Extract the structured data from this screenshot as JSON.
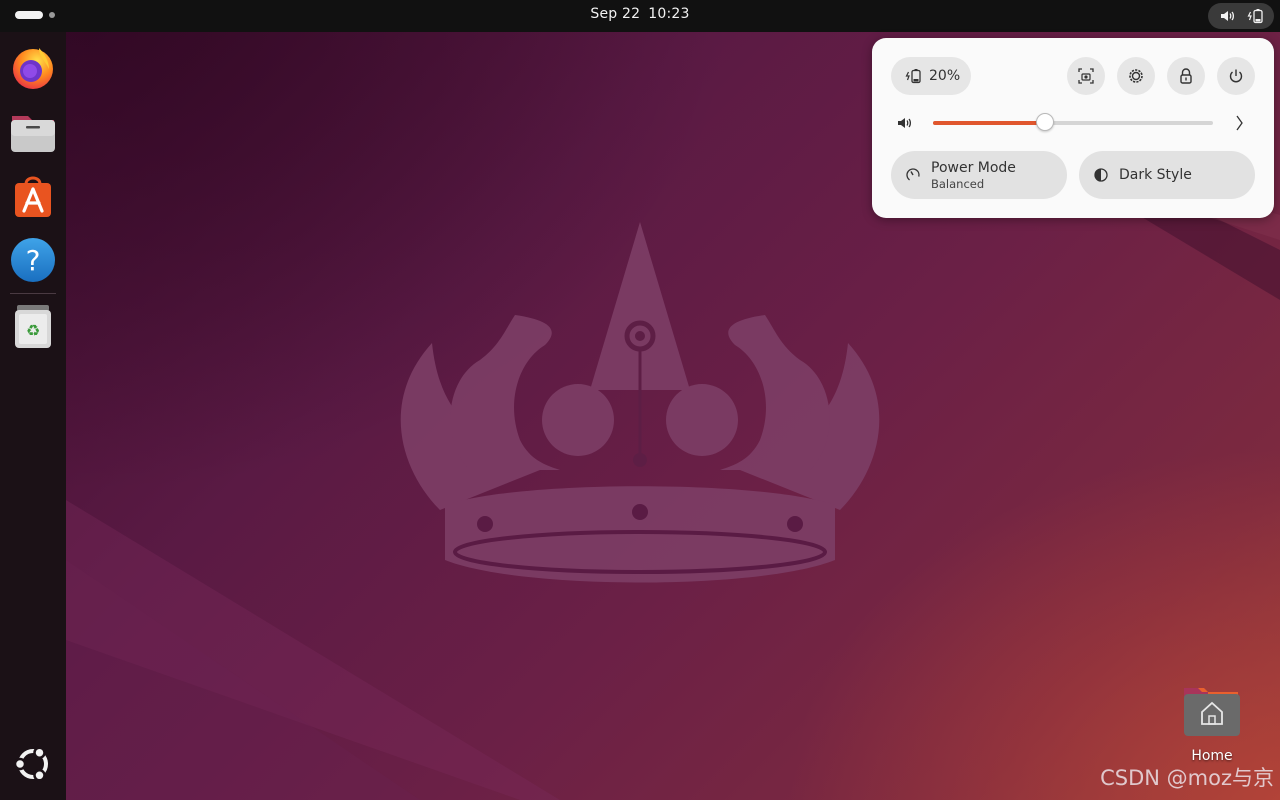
{
  "topbar": {
    "date": "Sep 22",
    "time": "10:23",
    "indicators": [
      "volume-icon",
      "battery-icon"
    ]
  },
  "dock": {
    "items": [
      {
        "name": "firefox",
        "icon": "firefox-icon"
      },
      {
        "name": "files",
        "icon": "files-icon"
      },
      {
        "name": "app-center",
        "icon": "app-center-icon"
      },
      {
        "name": "help",
        "icon": "help-icon"
      },
      {
        "name": "trash",
        "icon": "trash-icon"
      }
    ],
    "apps_button_icon": "ubuntu-logo-icon"
  },
  "quick_settings": {
    "battery_label": "20%",
    "buttons": [
      "screenshot-icon",
      "settings-icon",
      "lock-icon",
      "power-icon"
    ],
    "volume_level": 0.4,
    "power_mode": {
      "title": "Power Mode",
      "subtitle": "Balanced"
    },
    "dark_style": {
      "title": "Dark Style"
    }
  },
  "desktop": {
    "home_label": "Home"
  },
  "watermark": "CSDN @moz与京",
  "colors": {
    "accent": "#e0562d",
    "topbar": "#111111",
    "dock": "#1b1116",
    "panel": "#fafafa"
  }
}
